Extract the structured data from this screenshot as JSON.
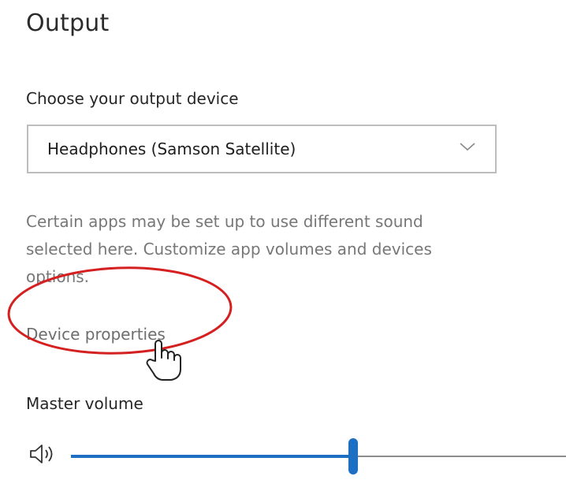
{
  "output": {
    "title": "Output",
    "choose_label": "Choose your output device",
    "device_dropdown": {
      "selected": "Headphones (Samson Satellite)",
      "icon": "chevron-down-icon"
    },
    "description_lines": [
      "Certain apps may be set up to use different sound",
      "selected here. Customize app volumes and devices",
      "options."
    ],
    "device_properties_link": "Device properties",
    "master_volume": {
      "label": "Master volume",
      "icon": "speaker-icon",
      "level_fraction": 0.57
    }
  },
  "annotation": {
    "color": "#d42020",
    "shape": "ellipse"
  },
  "accent_color": "#1d6fc4"
}
